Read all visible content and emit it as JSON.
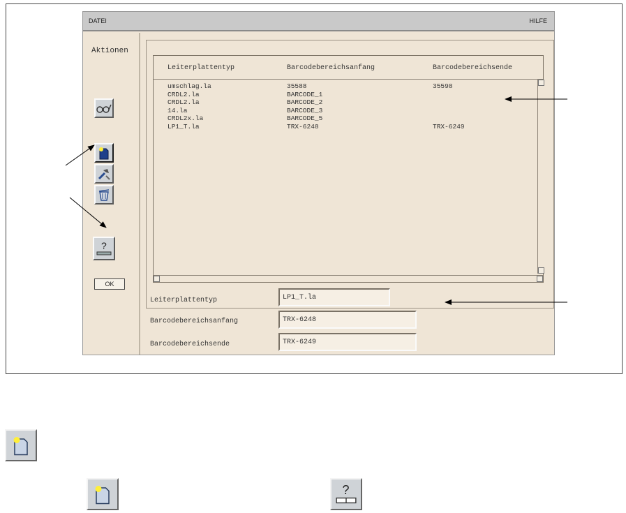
{
  "menubar": {
    "left": "DATEI",
    "right": "HILFE"
  },
  "leftpanel": {
    "title": "Aktionen",
    "ok_label": "OK",
    "icons": [
      "glasses-icon",
      "new-document-icon",
      "tools-icon",
      "wastebasket-icon",
      "help-icon"
    ]
  },
  "table": {
    "columns": [
      "Leiterplattentyp",
      "Barcodebereichsanfang",
      "Barcodebereichsende"
    ],
    "rows": [
      [
        "umschlag.la",
        "35588",
        "35598"
      ],
      [
        "CRDL2.la",
        "BARCODE_1",
        ""
      ],
      [
        "CRDL2.la",
        "BARCODE_2",
        ""
      ],
      [
        "14.la",
        "BARCODE_3",
        ""
      ],
      [
        "CRDL2x.la",
        "BARCODE_5",
        ""
      ],
      [
        "LP1_T.la",
        "TRX-6248",
        "TRX-6249"
      ]
    ]
  },
  "form": {
    "fields": [
      {
        "label": "Leiterplattentyp",
        "value": "LP1_T.la"
      },
      {
        "label": "Barcodebereichsanfang",
        "value": "TRX-6248"
      },
      {
        "label": "Barcodebereichsende",
        "value": "TRX-6249"
      }
    ]
  },
  "colors": {
    "window_bg": "#efe5d6",
    "menubar_bg": "#c9c9c9",
    "button_bg": "#cfd3d7",
    "new_icon_fill": "#1f3f8a"
  }
}
